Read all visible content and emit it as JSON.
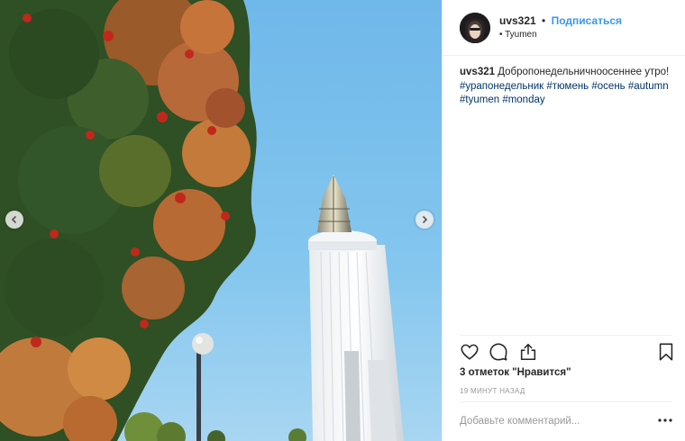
{
  "post": {
    "author": {
      "username": "uvs321",
      "follow_label": "Подписаться",
      "separator": "•"
    },
    "location": "• Tyumen",
    "caption": {
      "username": "uvs321",
      "text": "Добропонедельничноосеннее утро!",
      "hashtags": [
        "#урапонедельник",
        "#тюмень",
        "#осень",
        "#autumn",
        "#tyumen",
        "#monday"
      ]
    },
    "likes_text": "3 отметок \"Нравится\"",
    "time_text": "19 МИНУТ НАЗАД",
    "comment": {
      "placeholder": "Добавьте комментарий..."
    }
  },
  "icons": {
    "like": "heart-icon",
    "comment": "comment-icon",
    "share": "share-icon",
    "save": "bookmark-icon",
    "prev": "chevron-left-icon",
    "next": "chevron-right-icon",
    "more": "more-options-icon"
  },
  "colors": {
    "accent": "#3897f0",
    "hashtag": "#003569",
    "muted": "#999999",
    "sky": "#7cc0ea"
  }
}
